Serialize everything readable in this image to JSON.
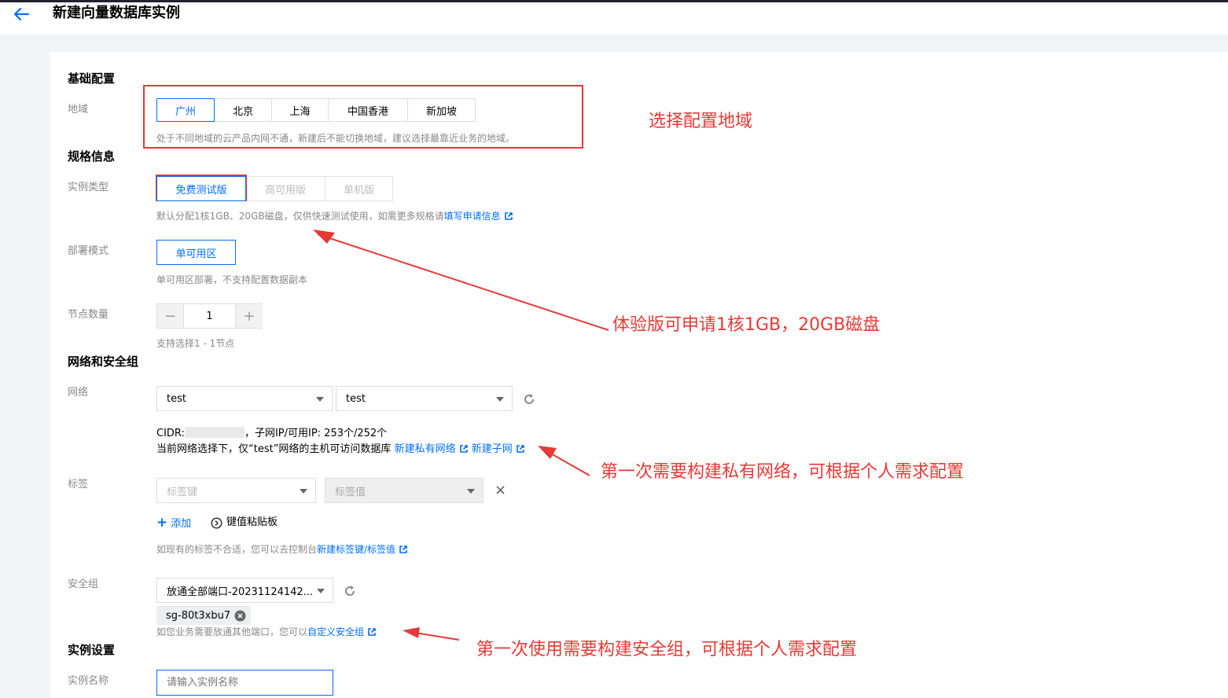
{
  "header": {
    "title": "新建向量数据库实例",
    "back_icon": "arrow-left-icon"
  },
  "sections": {
    "basic": "基础配置",
    "spec": "规格信息",
    "network": "网络和安全组",
    "instance": "实例设置"
  },
  "region": {
    "label": "地域",
    "options": [
      "广州",
      "北京",
      "上海",
      "中国香港",
      "新加坡"
    ],
    "selected": "广州",
    "hint": "处于不同地域的云产品内网不通，新建后不能切换地域，建议选择最靠近业务的地域。"
  },
  "instance_type": {
    "label": "实例类型",
    "options": [
      "免费测试版",
      "高可用版",
      "单机版"
    ],
    "selected": "免费测试版",
    "hint": "默认分配1核1GB、20GB磁盘，仅供快速测试使用，如需更多规格请",
    "hint_link": "填写申请信息"
  },
  "deploy": {
    "label": "部署模式",
    "option": "单可用区",
    "hint": "单可用区部署，不支持配置数据副本"
  },
  "nodes": {
    "label": "节点数量",
    "minus": "−",
    "value": "1",
    "plus": "+",
    "hint": "支持选择1 - 1节点"
  },
  "network": {
    "label": "网络",
    "vpc": "test",
    "subnet": "test",
    "cidr_label": "CIDR:",
    "subnet_ip": "，子网IP/可用IP: 253个/252个",
    "access_note": "当前网络选择下，仅“test”网络的主机可访问数据库",
    "link_vpc": "新建私有网络",
    "link_subnet": "新建子网"
  },
  "tags": {
    "label": "标签",
    "key_placeholder": "标签键",
    "value_placeholder": "标签值",
    "remove": "×",
    "add": "添加",
    "paste": "键值粘贴板",
    "hint": "如现有的标签不合适，您可以去控制台",
    "hint_link": "新建标签键/标签值"
  },
  "security_group": {
    "label": "安全组",
    "selected": "放通全部端口-20231124142...",
    "chip": "sg-80t3xbu7",
    "hint": "如您业务需要放通其他端口，您可以",
    "hint_link": "自定义安全组"
  },
  "instance_name": {
    "label": "实例名称",
    "placeholder": "请输入实例名称"
  },
  "annotations": {
    "region": "选择配置地域",
    "spec": "体验版可申请1核1GB，20GB磁盘",
    "network": "第一次需要构建私有网络，可根据个人需求配置",
    "security": "第一次使用需要构建安全组，可根据个人需求配置"
  },
  "colors": {
    "primary": "#006eff",
    "annotation": "#e53935"
  }
}
